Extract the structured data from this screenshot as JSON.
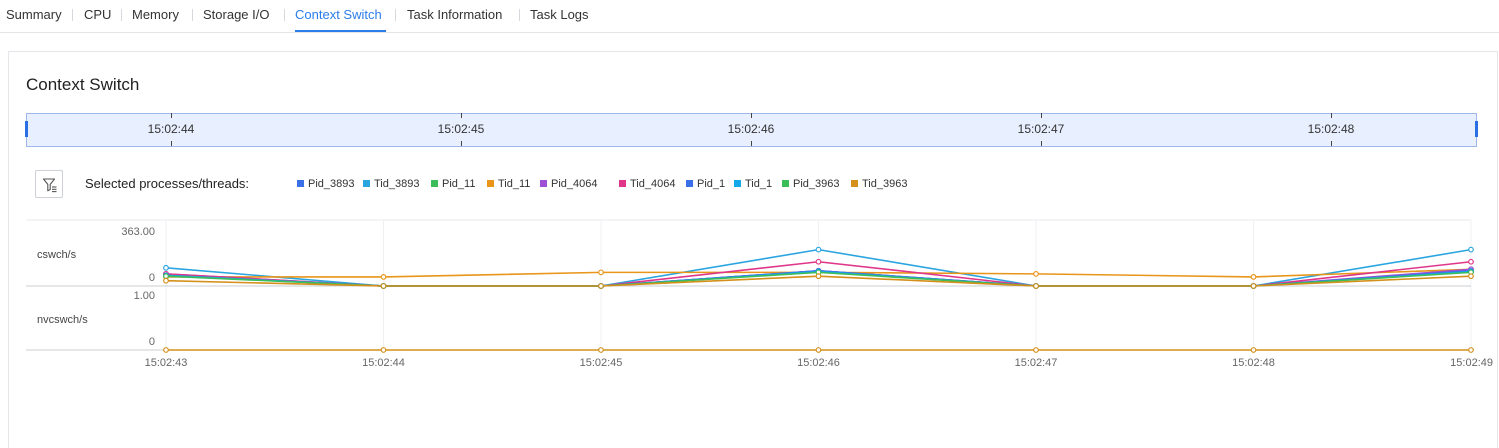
{
  "tabs": [
    {
      "label": "Summary",
      "active": false
    },
    {
      "label": "CPU",
      "active": false
    },
    {
      "label": "Memory",
      "active": false
    },
    {
      "label": "Storage I/O",
      "active": false
    },
    {
      "label": "Context Switch",
      "active": true
    },
    {
      "label": "Task Information",
      "active": false
    },
    {
      "label": "Task Logs",
      "active": false
    }
  ],
  "panel": {
    "title": "Context Switch",
    "brush_labels": [
      "15:02:44",
      "15:02:45",
      "15:02:46",
      "15:02:47",
      "15:02:48"
    ],
    "selected_label": "Selected processes/threads:",
    "filter_icon": "filter-icon"
  },
  "colors": {
    "accent": "#2b7de9",
    "Pid_3893": "#3b6fe8",
    "Tid_3893": "#2aa5e0",
    "Pid_11": "#3bbd5a",
    "Tid_11": "#e8951a",
    "Pid_4064": "#9d4fd6",
    "Tid_4064": "#e0368a",
    "Pid_1": "#3b6fe8",
    "Tid_1": "#13a9e8",
    "Pid_3963": "#3bbd5a",
    "Tid_3963": "#d4901a"
  },
  "chart_data": {
    "type": "line",
    "x": [
      "15:02:43",
      "15:02:44",
      "15:02:45",
      "15:02:46",
      "15:02:47",
      "15:02:48",
      "15:02:49"
    ],
    "panels": [
      {
        "ylabel": "cswch/s",
        "ymax_label": "363.00",
        "ymin_label": "0",
        "ylim": [
          0,
          363
        ],
        "series": [
          {
            "name": "Pid_3893",
            "color": "#3b6fe8",
            "values": [
              75,
              0,
              0,
              100,
              0,
              0,
              100
            ]
          },
          {
            "name": "Tid_3893",
            "color": "#2aa5e0",
            "values": [
              120,
              0,
              0,
              240,
              0,
              0,
              240
            ]
          },
          {
            "name": "Pid_11",
            "color": "#3bbd5a",
            "values": [
              70,
              0,
              0,
              95,
              0,
              0,
              95
            ]
          },
          {
            "name": "Tid_11",
            "color": "#e8951a",
            "values": [
              60,
              60,
              90,
              90,
              80,
              60,
              110
            ]
          },
          {
            "name": "Pid_4064",
            "color": "#9d4fd6",
            "values": [
              80,
              0,
              0,
              100,
              0,
              0,
              110
            ]
          },
          {
            "name": "Tid_4064",
            "color": "#e0368a",
            "values": [
              80,
              0,
              0,
              160,
              0,
              0,
              160
            ]
          },
          {
            "name": "Pid_1",
            "color": "#3b6fe8",
            "values": [
              70,
              0,
              0,
              100,
              0,
              0,
              100
            ]
          },
          {
            "name": "Tid_1",
            "color": "#13a9e8",
            "values": [
              70,
              0,
              0,
              95,
              0,
              0,
              95
            ]
          },
          {
            "name": "Pid_3963",
            "color": "#3bbd5a",
            "values": [
              65,
              0,
              0,
              90,
              0,
              0,
              90
            ]
          },
          {
            "name": "Tid_3963",
            "color": "#d4901a",
            "values": [
              35,
              0,
              0,
              65,
              0,
              0,
              65
            ]
          }
        ]
      },
      {
        "ylabel": "nvcswch/s",
        "ymax_label": "1.00",
        "ymin_label": "0",
        "ylim": [
          0,
          1
        ],
        "series": [
          {
            "name": "Tid_3963",
            "color": "#d4901a",
            "values": [
              0,
              0,
              0,
              0,
              0,
              0,
              0
            ]
          }
        ]
      }
    ]
  }
}
